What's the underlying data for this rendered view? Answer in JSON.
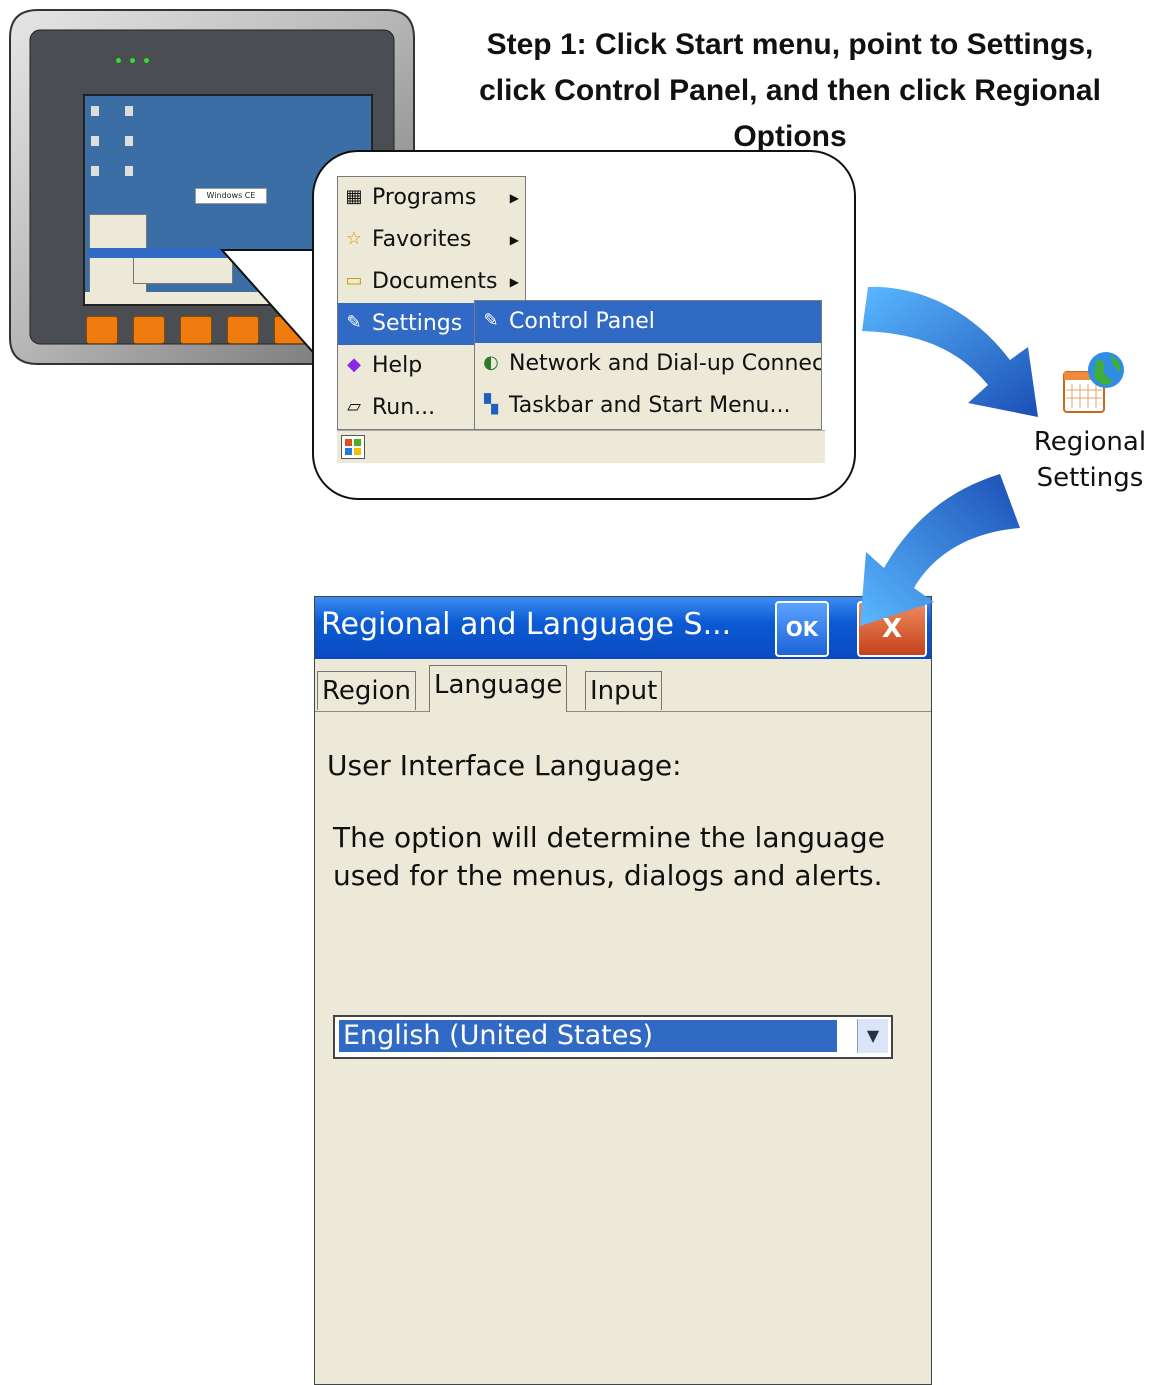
{
  "step": {
    "line1": "Step 1: Click Start menu, point to Settings,",
    "line2": "click Control Panel, and then click Regional",
    "line3": "Options"
  },
  "start_menu": {
    "items": [
      {
        "label": "Programs",
        "icon": "programs-icon"
      },
      {
        "label": "Favorites",
        "icon": "star-icon"
      },
      {
        "label": "Documents",
        "icon": "folder-icon"
      },
      {
        "label": "Settings",
        "icon": "settings-icon"
      },
      {
        "label": "Help",
        "icon": "help-book-icon"
      },
      {
        "label": "Run...",
        "icon": "run-icon"
      }
    ],
    "settings_submenu": [
      {
        "label": "Control Panel",
        "icon": "control-panel-icon"
      },
      {
        "label": "Network and Dial-up Connectio",
        "icon": "network-icon"
      },
      {
        "label": "Taskbar and Start Menu...",
        "icon": "taskbar-icon"
      }
    ]
  },
  "regional_icon": {
    "line1": "Regional",
    "line2": "Settings"
  },
  "dialog": {
    "title": "Regional and Language S...",
    "ok_label": "OK",
    "close_label": "X",
    "tabs": [
      "Region",
      "Language",
      "Input"
    ],
    "active_tab": "Language",
    "heading": "User Interface Language:",
    "description": "The option will determine the language used for the menus, dialogs and alerts.",
    "language_value": "English (United States)"
  },
  "colors": {
    "selection": "#316ac5",
    "titlebar": "#0b5bd4",
    "dialog_bg": "#ece9d8",
    "device_button": "#f07c10"
  }
}
